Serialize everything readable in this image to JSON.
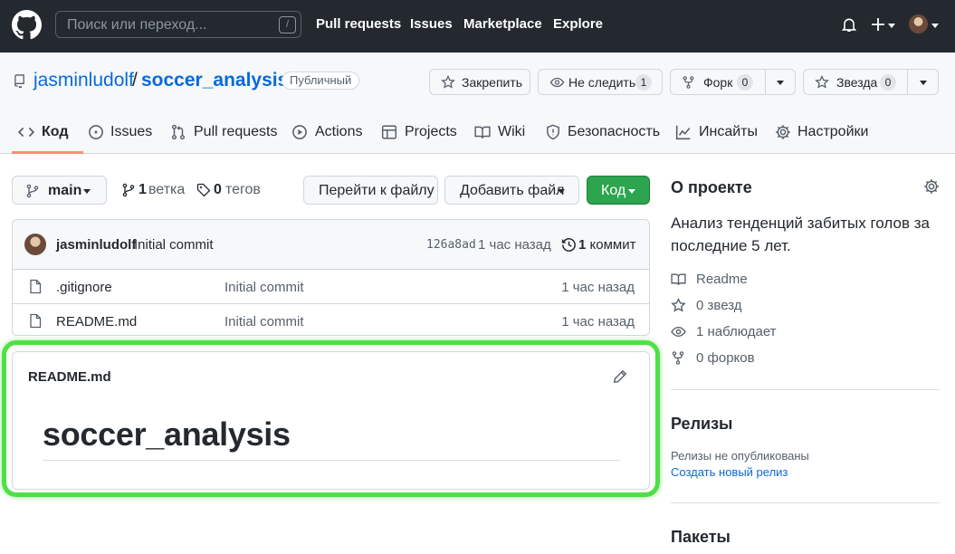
{
  "header": {
    "search_placeholder": "Поиск или переход...",
    "search_key": "/",
    "nav": [
      "Pull requests",
      "Issues",
      "Marketplace",
      "Explore"
    ]
  },
  "repo": {
    "owner": "jasminludolf",
    "separator": "/",
    "name": "soccer_analysis",
    "visibility": "Публичный",
    "actions": {
      "pin": "Закрепить",
      "watch": "Не следить",
      "watch_count": "1",
      "fork": "Форк",
      "fork_count": "0",
      "star": "Звезда",
      "star_count": "0"
    }
  },
  "tabs": [
    {
      "label": "Код",
      "icon": "code-icon"
    },
    {
      "label": "Issues",
      "icon": "issue-icon"
    },
    {
      "label": "Pull requests",
      "icon": "pull-request-icon"
    },
    {
      "label": "Actions",
      "icon": "play-icon"
    },
    {
      "label": "Projects",
      "icon": "table-icon"
    },
    {
      "label": "Wiki",
      "icon": "book-icon"
    },
    {
      "label": "Безопасность",
      "icon": "shield-icon"
    },
    {
      "label": "Инсайты",
      "icon": "graph-icon"
    },
    {
      "label": "Настройки",
      "icon": "gear-icon"
    }
  ],
  "filenav": {
    "branch": "main",
    "branches_count": "1",
    "branches_label": "ветка",
    "tags_count": "0",
    "tags_label": "тегов",
    "goto_file": "Перейти к файлу",
    "add_file": "Добавить файл",
    "code": "Код"
  },
  "commit": {
    "author": "jasminludolf",
    "message": "Initial commit",
    "sha": "126a8ad",
    "time": "1 час назад",
    "commits_count": "1",
    "commits_label": "коммит"
  },
  "files": [
    {
      "name": ".gitignore",
      "message": "Initial commit",
      "time": "1 час назад"
    },
    {
      "name": "README.md",
      "message": "Initial commit",
      "time": "1 час назад"
    }
  ],
  "readme": {
    "filename": "README.md",
    "heading": "soccer_analysis"
  },
  "sidebar": {
    "about_title": "О проекте",
    "description": "Анализ тенденций забитых голов за последние 5 лет.",
    "stats": [
      {
        "label": "Readme",
        "icon": "book-icon"
      },
      {
        "label": "0 звезд",
        "icon": "star-icon"
      },
      {
        "label": "1 наблюдает",
        "icon": "eye-icon"
      },
      {
        "label": "0 форков",
        "icon": "fork-icon"
      }
    ],
    "releases_title": "Релизы",
    "releases_empty": "Релизы не опубликованы",
    "releases_link": "Создать новый релиз",
    "packages_title": "Пакеты"
  },
  "colors": {
    "header_bg": "#24292f",
    "link": "#0969da",
    "primary_button": "#2da44e",
    "highlight": "#4fe046",
    "tab_underline": "#fd8c73"
  }
}
